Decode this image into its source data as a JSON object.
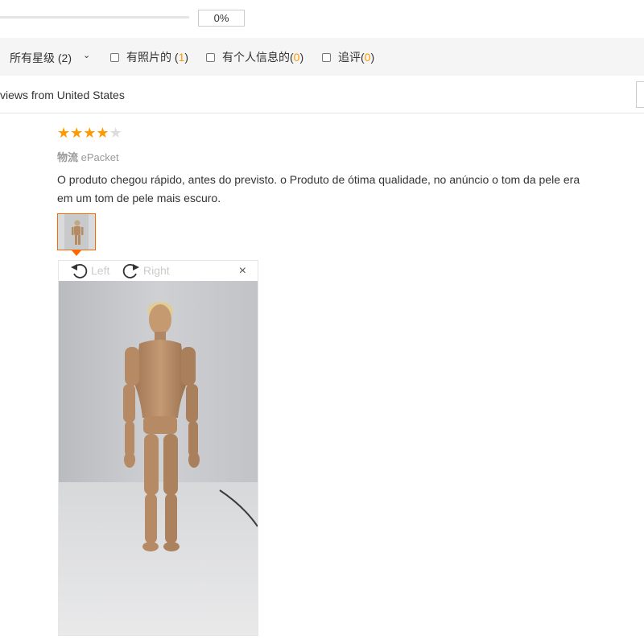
{
  "progress": {
    "percent_text": "0%",
    "value": 0
  },
  "filters": {
    "star_select": "所有星级 (2)",
    "items": [
      {
        "label": "有照片的",
        "count": "1"
      },
      {
        "label": "有个人信息的",
        "count": "0"
      },
      {
        "label": "追评",
        "count": "0"
      }
    ]
  },
  "reviews_header": "views from United States",
  "review": {
    "rating": 4,
    "max_rating": 5,
    "logistics_label": "物流",
    "logistics_value": "ePacket",
    "text_line1": "O produto chegou rápido, antes do previsto. o Produto de ótima qualidade, no anúncio o tom da pele era",
    "text_line2": "em um tom de pele mais escuro."
  },
  "viewer": {
    "rotate_left_label": "Left",
    "rotate_right_label": "Right",
    "close_symbol": "×"
  },
  "colors": {
    "accent": "#ff9900",
    "thumb_border": "#ff6600"
  },
  "icons": [
    "chevron-down-icon",
    "checkbox-icon",
    "star-icon",
    "rotate-left-icon",
    "rotate-right-icon",
    "close-icon"
  ]
}
